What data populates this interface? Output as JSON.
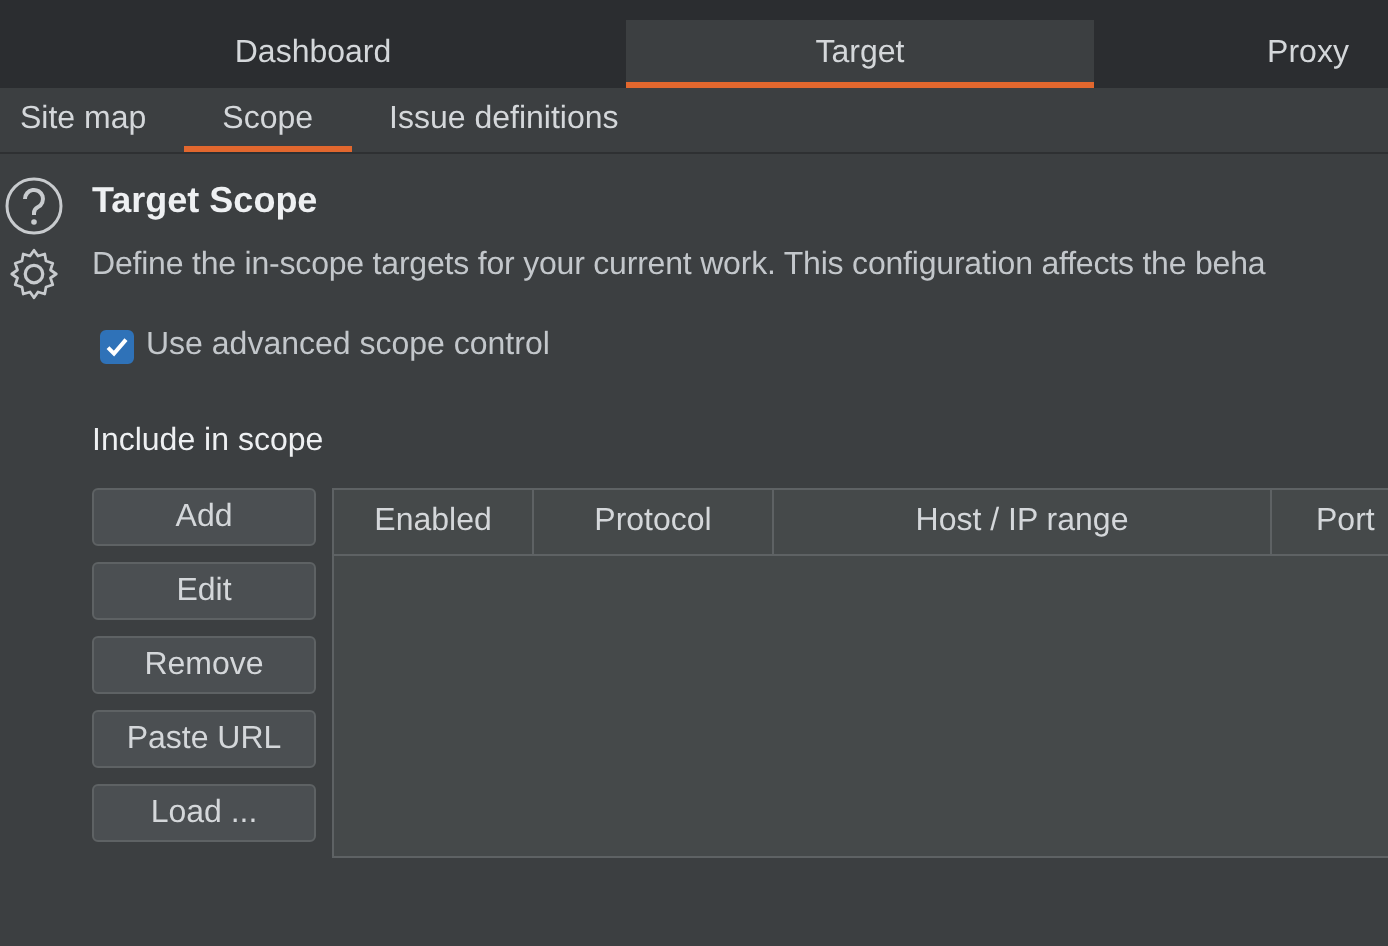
{
  "main_tabs": [
    {
      "label": "Dashboard",
      "selected": false
    },
    {
      "label": "Target",
      "selected": true
    },
    {
      "label": "Proxy",
      "selected": false
    }
  ],
  "sub_tabs": [
    {
      "label": "Site map",
      "selected": false
    },
    {
      "label": "Scope",
      "selected": true
    },
    {
      "label": "Issue definitions",
      "selected": false
    }
  ],
  "section": {
    "title": "Target Scope",
    "description": "Define the in-scope targets for your current work. This configuration affects the beha"
  },
  "advanced_scope": {
    "label": "Use advanced scope control",
    "checked": true
  },
  "include": {
    "heading": "Include in scope",
    "buttons": [
      "Add",
      "Edit",
      "Remove",
      "Paste URL",
      "Load ..."
    ],
    "columns": [
      "Enabled",
      "Protocol",
      "Host / IP range",
      "Port"
    ]
  }
}
